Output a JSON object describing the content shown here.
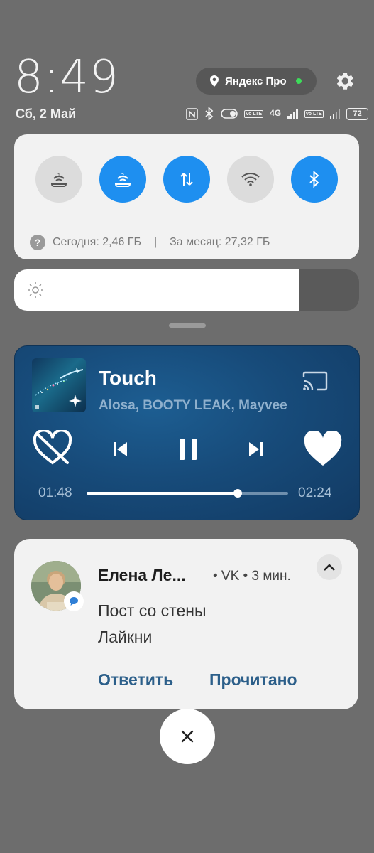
{
  "status": {
    "time": "8:49",
    "date": "Сб, 2 Май",
    "battery": "72",
    "network_label": "4G",
    "volte_label": "Vo LTE"
  },
  "header": {
    "yandex_label": "Яндекс Про"
  },
  "quick_settings": {
    "toggles": [
      {
        "icon": "sim1-data-icon",
        "state": "off"
      },
      {
        "icon": "sim2-data-icon",
        "state": "on"
      },
      {
        "icon": "mobile-data-icon",
        "state": "on"
      },
      {
        "icon": "wifi-icon",
        "state": "off"
      },
      {
        "icon": "bluetooth-icon",
        "state": "on"
      }
    ],
    "today_usage": "Сегодня: 2,46 ГБ",
    "separator": "|",
    "month_usage": "За месяц: 27,32 ГБ",
    "brightness_level": 0.826
  },
  "media": {
    "title": "Touch",
    "artist": "Alosa, BOOTY LEAK, Mayvee",
    "elapsed": "01:48",
    "duration": "02:24",
    "progress": 0.75
  },
  "notification": {
    "sender": "Елена Ле...",
    "meta": "• VK • 3 мин.",
    "line1": "Пост со стены",
    "line2": "Лайкни",
    "reply_label": "Ответить",
    "read_label": "Прочитано"
  },
  "colors": {
    "accent": "#1e8ff0",
    "panel": "#f2f2f2",
    "player_bg": "#174b7a",
    "action_text": "#2c5f8a"
  }
}
